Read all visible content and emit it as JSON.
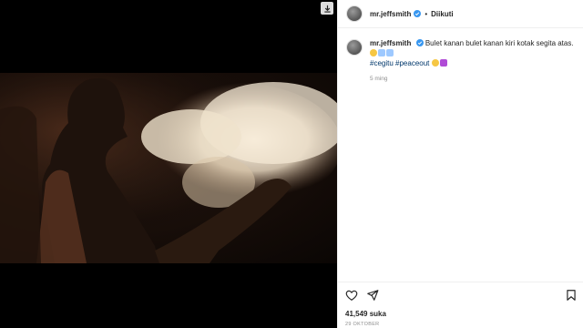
{
  "post": {
    "username": "mr.jeffsmith",
    "follow_state": "Diikuti",
    "separator": "•",
    "caption": "Bulet kanan bulet kanan kiri kotak segita atas.",
    "hashtags": [
      "#cegitu",
      "#peaceout"
    ],
    "time_ago": "5 ming",
    "likes": "41,549 suka",
    "date": "29 OKTOBER"
  },
  "colors": {
    "link": "#00376b",
    "verified": "#3897f0",
    "muted": "#8e8e8e"
  },
  "icons": {
    "header_verified": "verified-badge-icon",
    "like": "heart-icon",
    "share": "send-icon",
    "save": "bookmark-icon",
    "media_corner": "save-download-icon"
  }
}
